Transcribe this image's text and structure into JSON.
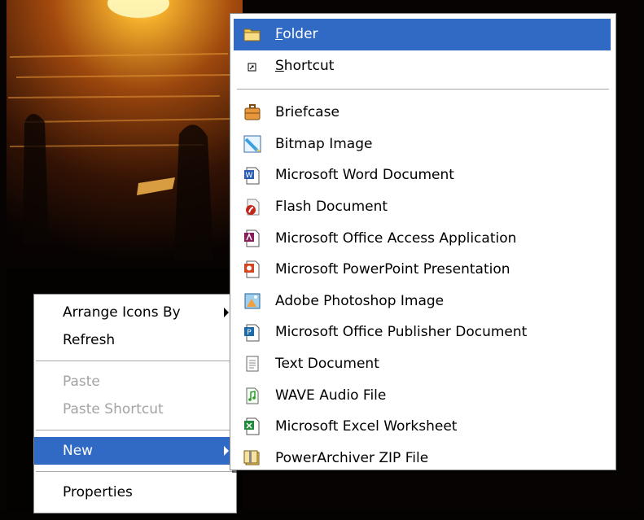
{
  "context_menu": {
    "items": [
      {
        "label": "Arrange Icons By",
        "submenu": true,
        "enabled": true
      },
      {
        "label": "Refresh",
        "enabled": true
      },
      {
        "label": "Paste",
        "enabled": false
      },
      {
        "label": "Paste Shortcut",
        "enabled": false
      },
      {
        "label": "New",
        "submenu": true,
        "selected": true,
        "enabled": true
      },
      {
        "label": "Properties",
        "enabled": true
      }
    ]
  },
  "new_submenu": {
    "folder": {
      "accel": "F",
      "rest": "older",
      "icon": "folder-icon"
    },
    "shortcut": {
      "accel": "S",
      "rest": "hortcut",
      "icon": "shortcut-icon"
    },
    "items": [
      {
        "label": "Briefcase",
        "icon": "briefcase-icon"
      },
      {
        "label": "Bitmap Image",
        "icon": "bitmap-image-icon"
      },
      {
        "label": "Microsoft Word Document",
        "icon": "word-document-icon"
      },
      {
        "label": "Flash Document",
        "icon": "flash-document-icon"
      },
      {
        "label": "Microsoft Office Access Application",
        "icon": "access-application-icon"
      },
      {
        "label": "Microsoft PowerPoint Presentation",
        "icon": "powerpoint-presentation-icon"
      },
      {
        "label": "Adobe Photoshop Image",
        "icon": "photoshop-image-icon"
      },
      {
        "label": "Microsoft Office Publisher Document",
        "icon": "publisher-document-icon"
      },
      {
        "label": "Text Document",
        "icon": "text-document-icon"
      },
      {
        "label": "WAVE Audio File",
        "icon": "wave-audio-icon"
      },
      {
        "label": "Microsoft Excel Worksheet",
        "icon": "excel-worksheet-icon"
      },
      {
        "label": "PowerArchiver ZIP File",
        "icon": "zip-file-icon"
      }
    ]
  },
  "colors": {
    "selection": "#316ac5",
    "disabled_text": "#a3a3a3"
  }
}
